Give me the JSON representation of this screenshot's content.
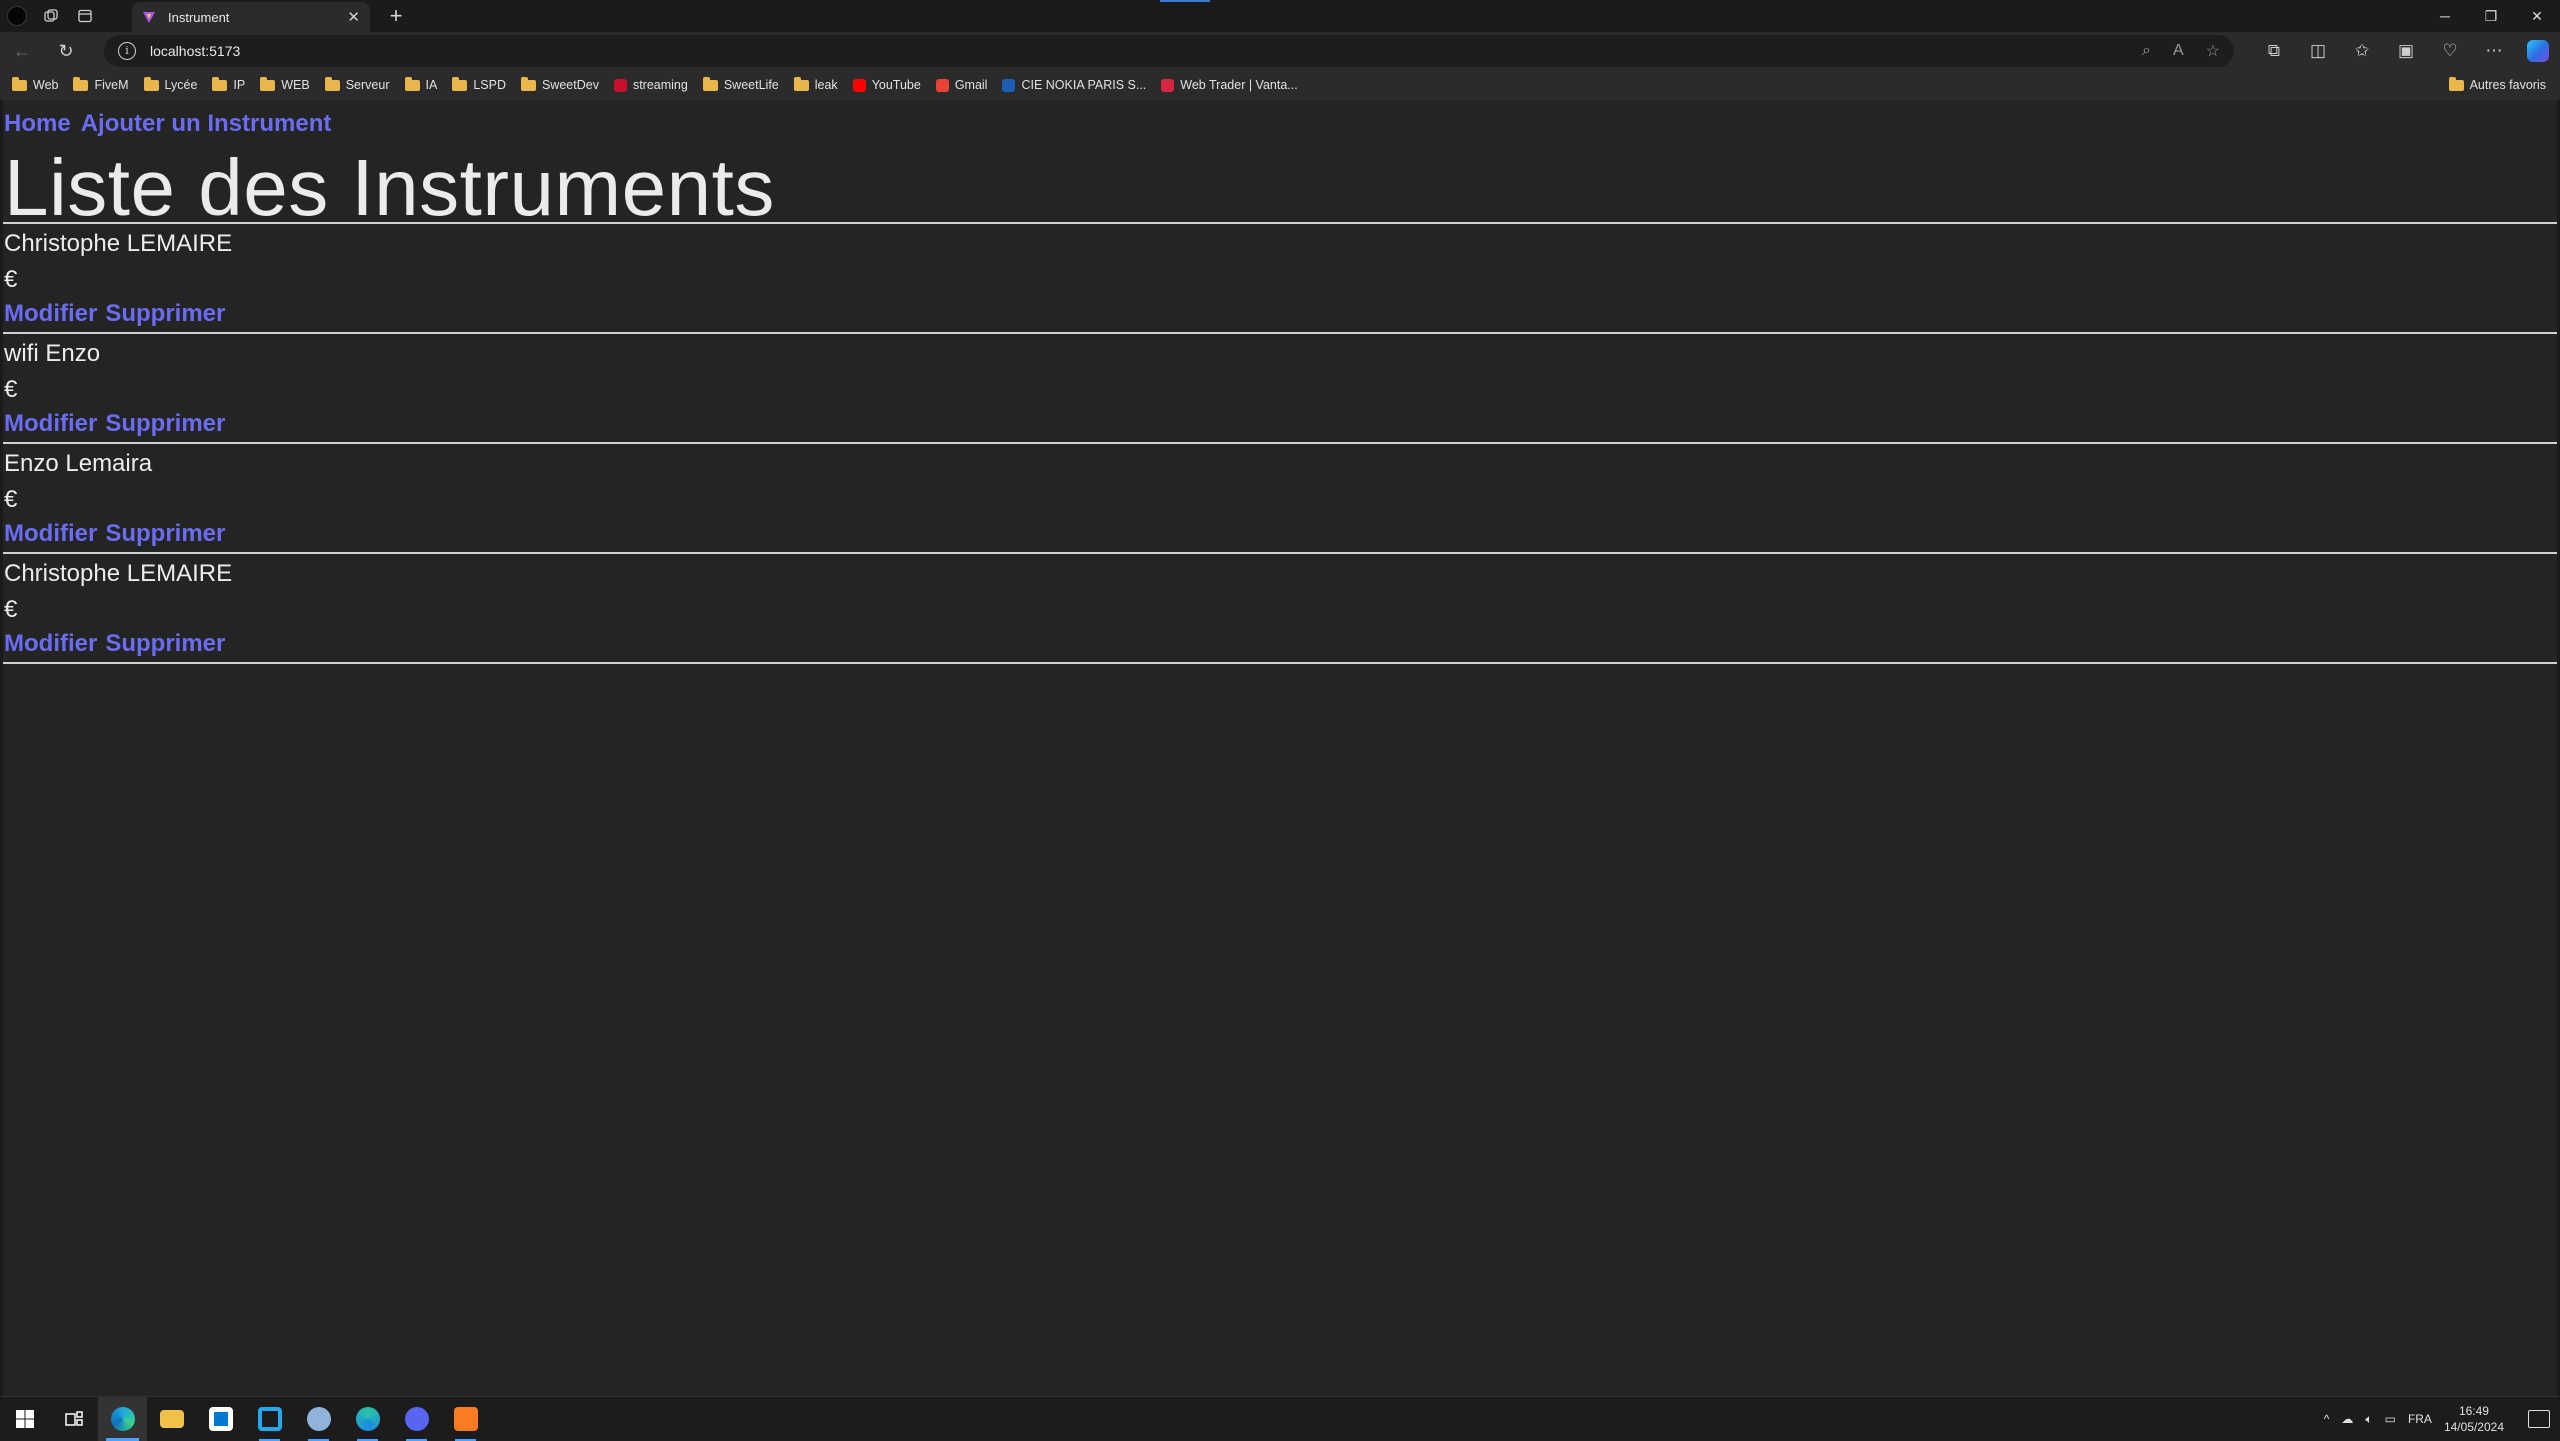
{
  "browser": {
    "tab": {
      "title": "Instrument",
      "close_glyph": "✕",
      "favicon": "vite-icon"
    },
    "new_tab_glyph": "+",
    "url": "localhost:5173",
    "window_controls": {
      "minimize": "─",
      "restore": "❐",
      "close": "✕"
    }
  },
  "bookmarks": [
    {
      "label": "Web",
      "icon": "folder-icon"
    },
    {
      "label": "FiveM",
      "icon": "folder-icon"
    },
    {
      "label": "Lycée",
      "icon": "folder-icon"
    },
    {
      "label": "IP",
      "icon": "folder-icon"
    },
    {
      "label": "WEB",
      "icon": "folder-icon"
    },
    {
      "label": "Serveur",
      "icon": "folder-icon"
    },
    {
      "label": "IA",
      "icon": "folder-icon"
    },
    {
      "label": "LSPD",
      "icon": "folder-icon"
    },
    {
      "label": "SweetDev",
      "icon": "folder-icon"
    },
    {
      "label": "streaming",
      "icon": "site-icon",
      "color": "#c8102e"
    },
    {
      "label": "SweetLife",
      "icon": "folder-icon"
    },
    {
      "label": "leak",
      "icon": "folder-icon"
    },
    {
      "label": "YouTube",
      "icon": "youtube-icon",
      "color": "#ff0000"
    },
    {
      "label": "Gmail",
      "icon": "gmail-icon",
      "color": "#ea4335"
    },
    {
      "label": "CIE NOKIA PARIS S...",
      "icon": "site-icon",
      "color": "#1a5fb4"
    },
    {
      "label": "Web Trader | Vanta...",
      "icon": "site-icon",
      "color": "#d7263d"
    }
  ],
  "bookmarks_other": "Autres favoris",
  "page": {
    "nav": {
      "home": "Home",
      "add": "Ajouter un Instrument"
    },
    "title": "Liste des Instruments",
    "items": [
      {
        "name": "Christophe LEMAIRE",
        "price": "€",
        "edit": "Modifier",
        "delete": "Supprimer"
      },
      {
        "name": "wifi Enzo",
        "price": "€",
        "edit": "Modifier",
        "delete": "Supprimer"
      },
      {
        "name": "Enzo Lemaira",
        "price": "€",
        "edit": "Modifier",
        "delete": "Supprimer"
      },
      {
        "name": "Christophe LEMAIRE",
        "price": "€",
        "edit": "Modifier",
        "delete": "Supprimer"
      }
    ]
  },
  "taskbar": {
    "apps": [
      "windows-start-icon",
      "task-view-icon",
      "edge-icon",
      "file-explorer-icon",
      "store-icon",
      "vscode-icon",
      "app-icon",
      "edge-beta-icon",
      "discord-icon",
      "xampp-icon"
    ],
    "tray": {
      "language": "FRA",
      "time": "16:49",
      "date": "14/05/2024",
      "chevron": "^"
    }
  },
  "colors": {
    "link": "#6a6cf2",
    "page_bg": "#242424",
    "accent": "#4aa3ff"
  }
}
